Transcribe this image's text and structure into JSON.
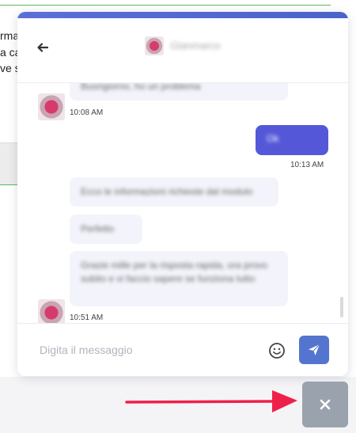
{
  "background": {
    "text_lines": [
      "rma",
      "a ca",
      "ve s"
    ]
  },
  "chat": {
    "header": {
      "contact_name": "Gianmarco",
      "back_icon": "arrow-left-icon"
    },
    "messages": [
      {
        "side": "in",
        "text": "Buongiorno, ho un problema",
        "time": "10:08 AM"
      },
      {
        "side": "out",
        "text": "Ok",
        "time": "10:13 AM"
      },
      {
        "side": "in",
        "text": "Ecco le informazioni richieste dal modulo",
        "time": ""
      },
      {
        "side": "in",
        "text": "Perfetto",
        "time": ""
      },
      {
        "side": "in",
        "text": "Grazie mille per la risposta rapida, ora provo subito e vi faccio sapere se funziona tutto",
        "time": "10:51 AM"
      }
    ],
    "composer": {
      "placeholder": "Digita il messaggio",
      "emoji_icon": "emoji-smile-icon",
      "send_icon": "send-icon"
    }
  },
  "close_button": {
    "icon": "close-icon"
  },
  "colors": {
    "accent": "#5475cf",
    "outgoing_bubble": "#5458d8",
    "incoming_bubble": "#f3f4fb",
    "close_button": "#9aa3ad",
    "annotation_arrow": "#ef1f4b"
  }
}
